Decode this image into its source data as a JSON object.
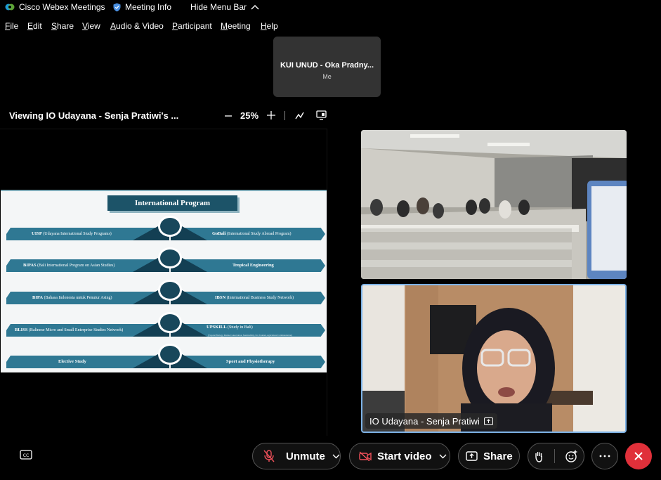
{
  "titlebar": {
    "app_name": "Cisco Webex Meetings",
    "meeting_info": "Meeting Info",
    "hide_menu": "Hide Menu Bar"
  },
  "menu": [
    "File",
    "Edit",
    "Share",
    "View",
    "Audio & Video",
    "Participant",
    "Meeting",
    "Help"
  ],
  "self_view": {
    "name": "KUI UNUD - Oka Pradny...",
    "label": "Me"
  },
  "share_toolbar": {
    "viewing": "Viewing IO Udayana - Senja Pratiwi's ...",
    "zoom": "25%"
  },
  "slide": {
    "title": "International Program",
    "rows": [
      {
        "left_bold": "UISP",
        "left_rest": " (Udayana International Study Programs)",
        "right_bold": "GoBali",
        "right_rest": " (International Study Abroad Program)",
        "right_sub": ""
      },
      {
        "left_bold": "BIPAS",
        "left_rest": " (Bali International Program on Asian Studies)",
        "right_bold": "Tropical Engineering",
        "right_rest": "",
        "right_sub": ""
      },
      {
        "left_bold": "BIPA",
        "left_rest": " (Bahasa Indonesia untuk Penutur Asing)",
        "right_bold": "IBSN",
        "right_rest": " (International Business Study Network)",
        "right_sub": ""
      },
      {
        "left_bold": "BLISS",
        "left_rest": " (Balinese Micro and Small Enterprise Studies Network)",
        "right_bold": "UPSKILL",
        "right_rest": " (Study in Bali)",
        "right_sub": "(Tropical Biology, Marine Conservation, Sustainability, Eco Tourism, Agricultural Communication)"
      },
      {
        "left_bold": "Elective Study",
        "left_rest": "",
        "right_bold": "Sport and Physiotherapy",
        "right_rest": "",
        "right_sub": ""
      }
    ]
  },
  "videos": {
    "speaker_name": "IO Udayana - Senja Pratiwi"
  },
  "controls": {
    "unmute": "Unmute",
    "start_video": "Start video",
    "share": "Share"
  },
  "colors": {
    "end_call": "#e0303a",
    "active_speaker_border": "#7db2e6",
    "slide_accent": "#2f7893"
  }
}
